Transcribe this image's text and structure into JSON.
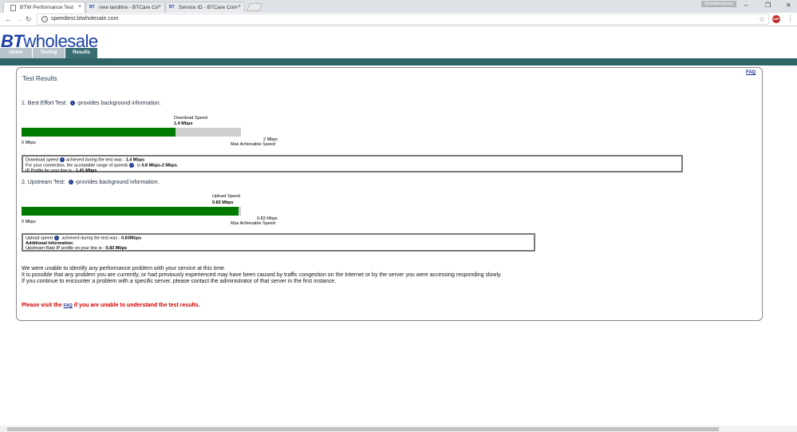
{
  "browser": {
    "tabs": [
      {
        "title": "BTW Performance Test",
        "favicon": "page-icon",
        "active": true
      },
      {
        "title": "new landline - BTCare Co",
        "favicon": "BT"
      },
      {
        "title": "Service ID - BTCare Com",
        "favicon": "BT"
      }
    ],
    "url": "speedtest.btwholesale.com",
    "user_badge": "BoinMandaman",
    "ext_label": "ABP"
  },
  "site": {
    "logo_bt": "BT",
    "logo_rest": "wholesale",
    "nav": [
      {
        "label": "Home"
      },
      {
        "label": "Testing"
      },
      {
        "label": "Results",
        "active": true
      }
    ]
  },
  "results": {
    "faq": "FAQ",
    "title": "Test Results",
    "best_effort": {
      "heading_pre": "1. Best Effort Test:",
      "heading_post": "-provides background information.",
      "bar_caption": "Download  Speed",
      "speed": "1.4 Mbps",
      "scale_min": "0 Mbps",
      "scale_max": "2 Mbps",
      "scale_max_label": "Max Achievable Speed",
      "fill_fraction": 0.7,
      "info": {
        "l1_pre": "Download speed",
        "l1_mid": "achieved during the test was - ",
        "l1_val": "1.4 Mbps",
        "l2_pre": "For your connection, the acceptable range of speeds",
        "l2_mid": " is ",
        "l2_val": "0.8 Mbps-2 Mbps.",
        "l3_pre": "IP Profile for your line is - ",
        "l3_val": "1.41 Mbps"
      }
    },
    "upstream": {
      "heading_pre": "2. Upstream Test:",
      "heading_post": "-provides background information.",
      "bar_caption": "Upload Speed",
      "speed": "0.83 Mbps",
      "scale_min": "0 Mbps",
      "scale_max": "0.83 Mbps",
      "scale_max_label": "Max Achievable Speed",
      "fill_fraction": 0.99,
      "info": {
        "l1_pre": "Upload speed",
        "l1_mid": " achieved during the test was - ",
        "l1_val": "0.83Mbps",
        "l2": "Additional Information:",
        "l3_pre": "Upstream Rate IP profile on your line is - ",
        "l3_val": "0.83 Mbps"
      }
    },
    "message": [
      "We were unable to identify any performance problem with your service at this time.",
      "It is possible that any problem you are currently, or had previously experienced may have been caused by traffic congestion on the Internet or by the server you were accessing responding slowly.",
      "If you continue to encounter a problem with a specific server, please contact the administrator of that server in the first instance."
    ],
    "visit_pre": "Please visit the ",
    "visit_link": "FAQ",
    "visit_post": " if you are unable to understand the test results."
  },
  "colors": {
    "brand": "#1b3fa5",
    "band": "#2f6467",
    "bar_fill": "#007a00",
    "alert": "#d00000"
  }
}
